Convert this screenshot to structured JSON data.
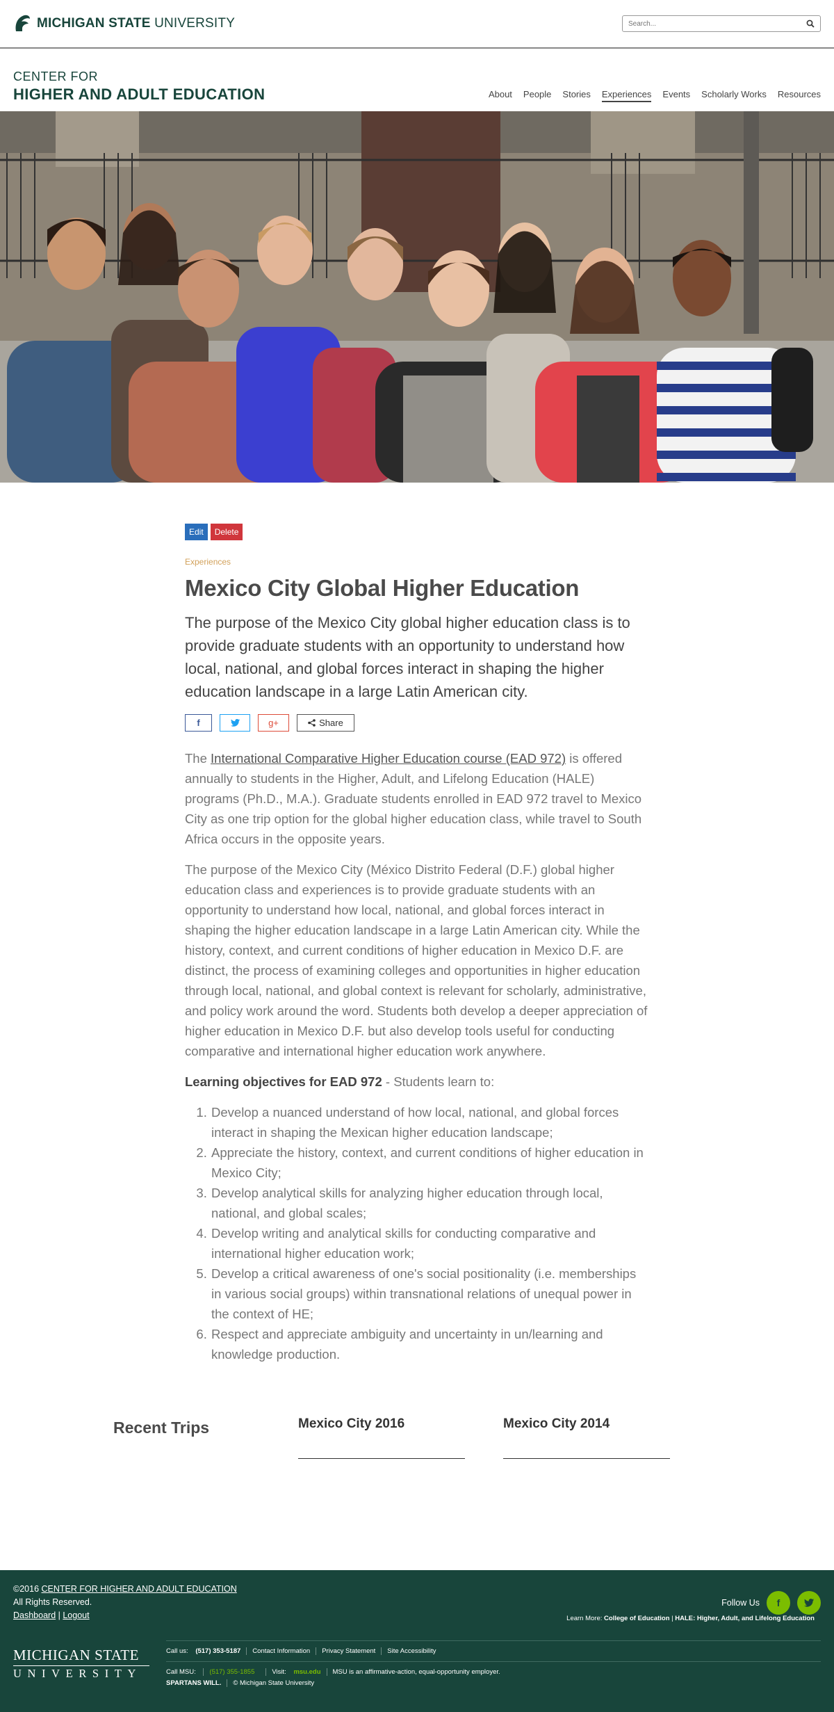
{
  "topbar": {
    "logo_bold": "MICHIGAN STATE",
    "logo_light": " UNIVERSITY",
    "search_placeholder": "Search..."
  },
  "header": {
    "center_line1": "CENTER FOR",
    "center_line2": "HIGHER AND ADULT EDUCATION",
    "nav": [
      {
        "label": "About"
      },
      {
        "label": "People"
      },
      {
        "label": "Stories"
      },
      {
        "label": "Experiences",
        "active": true
      },
      {
        "label": "Events"
      },
      {
        "label": "Scholarly Works"
      },
      {
        "label": "Resources"
      }
    ]
  },
  "admin": {
    "edit": "Edit",
    "delete": "Delete"
  },
  "article": {
    "category": "Experiences",
    "title": "Mexico City Global Higher Education",
    "lede": "The purpose of the Mexico City global higher education class is to provide graduate students with an opportunity to understand how local, national, and global forces interact in shaping the higher education landscape in a large Latin American city.",
    "share": {
      "facebook": "f",
      "twitter": "t",
      "google": "g+",
      "share": "Share"
    },
    "p1_pre": "The ",
    "p1_link": "International Comparative Higher Education course (EAD 972)",
    "p1_post": " is offered annually to students in the Higher, Adult, and Lifelong Education (HALE) programs (Ph.D., M.A.). Graduate students enrolled in EAD 972 travel to Mexico City as one trip option for the global higher education class, while travel to South Africa occurs in the opposite years.",
    "p2": "The purpose of the Mexico City (México Distrito Federal (D.F.) global higher education class and experiences is to provide graduate students with an opportunity to understand how local, national, and global forces interact in shaping the higher education landscape in a large Latin American city. While the history, context, and current conditions of higher education in Mexico D.F. are distinct, the process of examining colleges and opportunities in higher education through local, national, and global context is relevant for scholarly, administrative, and policy work around the word. Students both develop a deeper appreciation of higher education in Mexico D.F. but also develop tools useful for conducting comparative and international higher education work anywhere.",
    "objectives_bold": "Learning objectives for EAD 972",
    "objectives_rest": " - Students learn to:",
    "objectives": [
      "Develop a nuanced understand of how local, national, and global forces interact in shaping the Mexican higher education landscape;",
      "Appreciate the history, context, and current conditions of higher education in Mexico City;",
      "Develop analytical skills for analyzing higher education through local, national, and global scales;",
      "Develop writing and analytical skills for conducting comparative and international higher education work;",
      "Develop a critical awareness of one's social positionality (i.e. memberships in various social groups) within transnational relations of unequal power in the context of HE;",
      "Respect and appreciate ambiguity and uncertainty in un/learning and knowledge production."
    ]
  },
  "recent": {
    "title": "Recent Trips",
    "trips": [
      "Mexico City 2016",
      "Mexico City 2014"
    ]
  },
  "footer": {
    "copyright_year": "©2016 ",
    "copyright_link": "CENTER FOR HIGHER AND ADULT EDUCATION ",
    "rights": "All Rights Reserved.",
    "dashboard": "Dashboard",
    "sep": " | ",
    "logout": "Logout",
    "follow": "Follow Us",
    "facebook": "f",
    "twitter": "t",
    "learn_more_label": "Learn More: ",
    "learn_more_coe": "College of Education",
    "learn_more_sep": " | ",
    "learn_more_hale": "HALE: Higher, Adult, and Lifelong Education",
    "msu_line1": "MICHIGAN STATE",
    "msu_line2": "UNIVERSITY",
    "call_us_label": "Call us: ",
    "call_us_number": "(517) 353-5187",
    "contact": "Contact Information",
    "privacy": "Privacy Statement",
    "accessibility": "Site Accessibility",
    "call_msu_label": "Call MSU: ",
    "call_msu_number": "(517) 355-1855",
    "visit_label": "Visit: ",
    "visit_link": "msu.edu",
    "eeo": "MSU is an affirmative-action, equal-opportunity employer.",
    "spartans": "SPARTANS WILL.",
    "copyright_msu": "© Michigan State University"
  },
  "colors": {
    "msu_green": "#18453b",
    "accent_green": "#7bbd00",
    "edit_blue": "#2a6ebb",
    "delete_red": "#d0363c",
    "category_gold": "#d2a15b"
  }
}
